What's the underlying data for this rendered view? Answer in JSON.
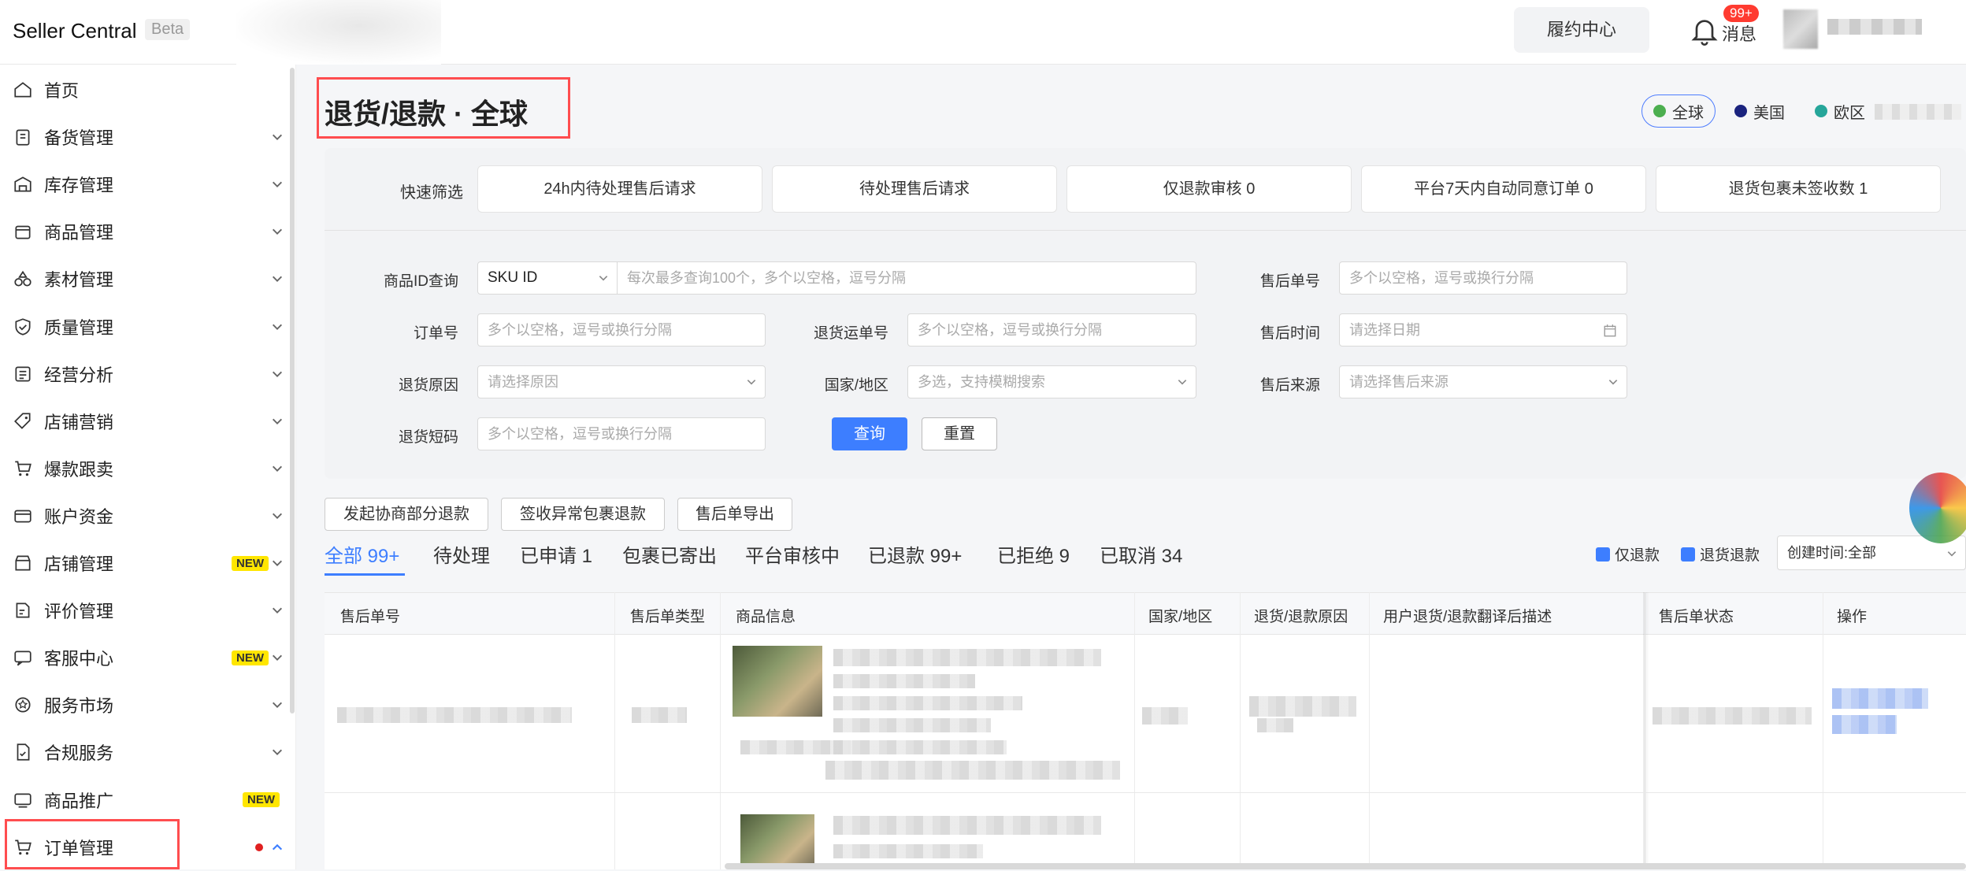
{
  "header": {
    "brand": "Seller Central",
    "beta": "Beta",
    "fulfillment_center": "履约中心",
    "notifications_label": "消息",
    "notifications_badge": "99+"
  },
  "sidebar": {
    "items": [
      {
        "label": "首页",
        "icon": "home-icon"
      },
      {
        "label": "备货管理",
        "icon": "clipboard-icon"
      },
      {
        "label": "库存管理",
        "icon": "warehouse-icon"
      },
      {
        "label": "商品管理",
        "icon": "box-icon"
      },
      {
        "label": "素材管理",
        "icon": "shapes-icon"
      },
      {
        "label": "质量管理",
        "icon": "shield-check-icon"
      },
      {
        "label": "经营分析",
        "icon": "report-icon"
      },
      {
        "label": "店铺营销",
        "icon": "tag-icon"
      },
      {
        "label": "爆款跟卖",
        "icon": "cart-trend-icon"
      },
      {
        "label": "账户资金",
        "icon": "wallet-icon"
      },
      {
        "label": "店铺管理",
        "icon": "store-icon",
        "badge": "NEW"
      },
      {
        "label": "评价管理",
        "icon": "review-icon"
      },
      {
        "label": "客服中心",
        "icon": "chat-icon",
        "badge": "NEW"
      },
      {
        "label": "服务市场",
        "icon": "badge-icon"
      },
      {
        "label": "合规服务",
        "icon": "document-check-icon"
      },
      {
        "label": "商品推广",
        "icon": "ad-icon",
        "badge": "NEW"
      },
      {
        "label": "订单管理",
        "icon": "cart-icon"
      }
    ]
  },
  "page": {
    "title": "退货/退款 · 全球",
    "regions": [
      {
        "label": "全球",
        "color": "#4caf50"
      },
      {
        "label": "美国",
        "color": "#1a237e"
      },
      {
        "label": "欧区",
        "color": "#26a69a"
      }
    ]
  },
  "quick_filter": {
    "label": "快速筛选",
    "buttons": [
      "24h内待处理售后请求",
      "待处理售后请求",
      "仅退款审核  0",
      "平台7天内自动同意订单  0",
      "退货包裹未签收数  1"
    ]
  },
  "search": {
    "product_id_label": "商品ID查询",
    "sku_select": "SKU ID",
    "sku_placeholder": "每次最多查询100个，多个以空格，逗号分隔",
    "aftersale_no_label": "售后单号",
    "aftersale_no_placeholder": "多个以空格，逗号或换行分隔",
    "order_no_label": "订单号",
    "order_no_placeholder": "多个以空格，逗号或换行分隔",
    "return_tracking_label": "退货运单号",
    "return_tracking_placeholder": "多个以空格，逗号或换行分隔",
    "aftersale_time_label": "售后时间",
    "aftersale_time_placeholder": "请选择日期",
    "return_reason_label": "退货原因",
    "return_reason_placeholder": "请选择原因",
    "country_label": "国家/地区",
    "country_placeholder": "多选，支持模糊搜索",
    "source_label": "售后来源",
    "source_placeholder": "请选择售后来源",
    "return_code_label": "退货短码",
    "return_code_placeholder": "多个以空格，逗号或换行分隔",
    "query_button": "查询",
    "reset_button": "重置"
  },
  "actions": [
    "发起协商部分退款",
    "签收异常包裹退款",
    "售后单导出"
  ],
  "tabs": [
    {
      "label": "全部 99+"
    },
    {
      "label": "待处理"
    },
    {
      "label": "已申请 1"
    },
    {
      "label": "包裹已寄出"
    },
    {
      "label": "平台审核中"
    },
    {
      "label": "已退款 99+"
    },
    {
      "label": "已拒绝 9"
    },
    {
      "label": "已取消 34"
    }
  ],
  "filters": {
    "refund_only": "仅退款",
    "return_refund": "退货退款",
    "sort": "创建时间:全部"
  },
  "table": {
    "columns": [
      "售后单号",
      "售后单类型",
      "商品信息",
      "国家/地区",
      "退货/退款原因",
      "用户退货/退款翻译后描述",
      "售后单状态",
      "操作"
    ]
  }
}
